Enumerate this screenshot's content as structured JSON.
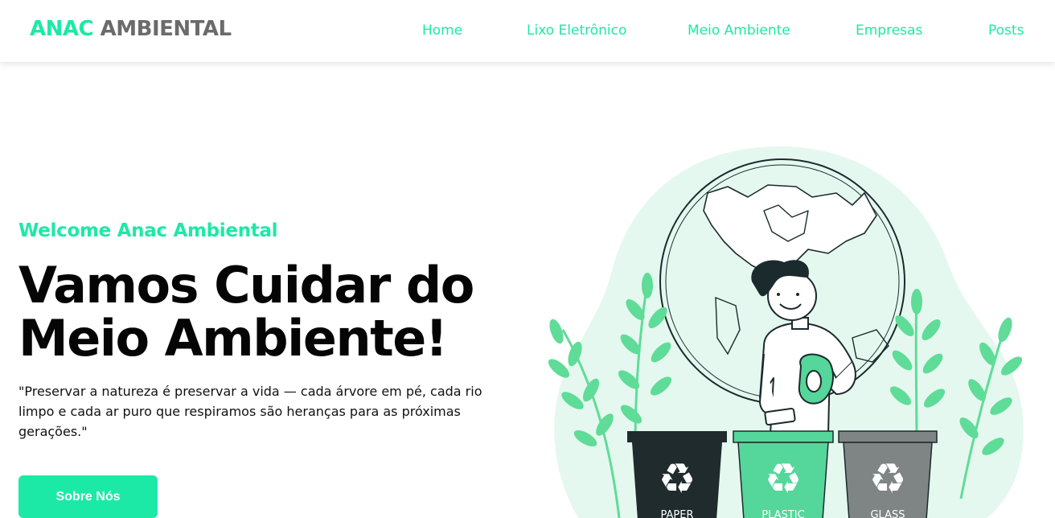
{
  "brand": {
    "part1": "ANAC",
    "part2": "AMBIENTAL"
  },
  "nav": {
    "items": [
      {
        "label": "Home"
      },
      {
        "label": "Lixo Eletrônico"
      },
      {
        "label": "Meio Ambiente"
      },
      {
        "label": "Empresas"
      },
      {
        "label": "Posts"
      }
    ]
  },
  "hero": {
    "welcome": "Welcome Anac Ambiental",
    "headline_line1": "Vamos Cuidar do",
    "headline_line2": "Meio Ambiente!",
    "quote": "\"Preservar a natureza é preservar a vida — cada árvore em pé, cada rio limpo e cada ar puro que respiramos são heranças para as próximas gerações.\"",
    "cta_label": "Sobre Nós"
  },
  "illustration": {
    "bins": [
      {
        "label": "PAPER",
        "color": "#1f2b2d"
      },
      {
        "label": "PLASTIC",
        "color": "#55d69a"
      },
      {
        "label": "GLASS",
        "color": "#7f8584"
      }
    ]
  },
  "colors": {
    "accent": "#1de9a6",
    "blob": "#e5f8ef",
    "leaf": "#5fdc98"
  }
}
